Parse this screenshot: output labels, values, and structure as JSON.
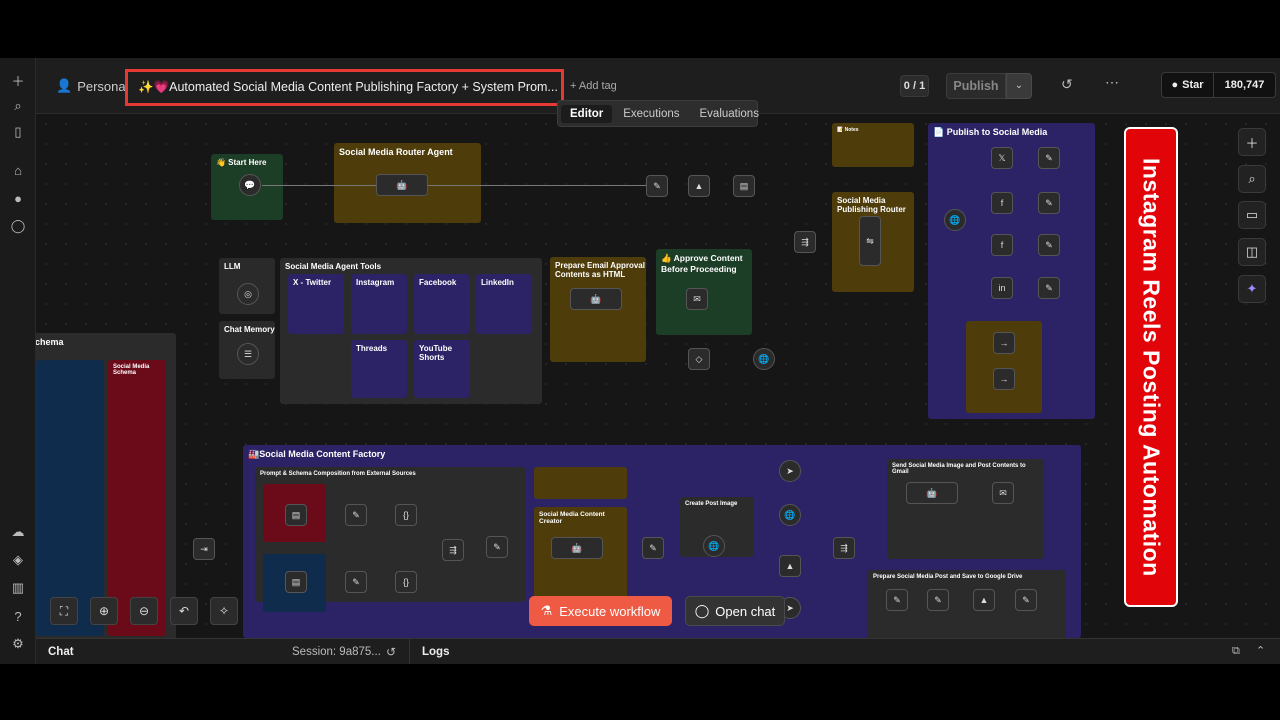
{
  "header": {
    "personal_label": "Personal",
    "workflow_title": "✨💗Automated Social Media Content Publishing Factory + System Prom...",
    "add_tag": "+ Add tag",
    "counter": "0 / 1",
    "publish_label": "Publish",
    "star_label": "Star",
    "star_count": "180,747"
  },
  "tabs": [
    {
      "label": "Editor",
      "active": true
    },
    {
      "label": "Executions",
      "active": false
    },
    {
      "label": "Evaluations",
      "active": false
    }
  ],
  "canvas": {
    "stickies": {
      "start_here": "👋 Start Here",
      "router_agent": "Social Media Router Agent",
      "llm": "LLM",
      "chat_memory": "Chat Memory",
      "agent_tools": "Social Media Agent Tools",
      "prepare_email": "Prepare Email Approval Contents as HTML",
      "approve_content": "👍 Approve Content Before Proceeding",
      "notes_top": "📝 Notes",
      "publishing_router": "Social Media Publishing Router",
      "publish_social": "📄 Publish to Social Media",
      "schema_left": "chema",
      "social_schema": "Social Media Schema",
      "content_factory": "🏭Social Media Content Factory",
      "prompt_schema": "Prompt & Schema Composition from External Sources",
      "content_creator": "Social Media Content Creator",
      "create_post_image": "Create Post Image",
      "send_gmail": "Send Social Media Image and Post Contents to Gmail",
      "prepare_save": "Prepare Social Media Post and Save to Google Drive"
    },
    "tools": [
      "X - Twitter",
      "Instagram",
      "Facebook",
      "LinkedIn",
      "Threads",
      "YouTube Shorts"
    ],
    "banner_text": "Instagram Reels Posting Automation"
  },
  "controls": {
    "execute_label": "Execute workflow",
    "open_chat_label": "Open chat"
  },
  "footer": {
    "chat_label": "Chat",
    "session_label": "Session: 9a875...",
    "logs_label": "Logs"
  }
}
